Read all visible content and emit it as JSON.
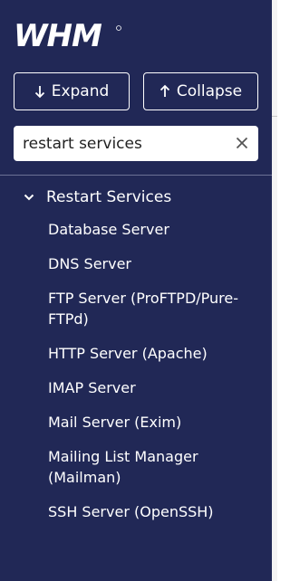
{
  "brand": {
    "logo_text": "WHM",
    "colors": {
      "sidebar_bg": "#212856",
      "text": "#ffffff",
      "search_bg": "#ffffff"
    }
  },
  "toolbar": {
    "expand_label": "Expand",
    "expand_icon": "arrow-down-icon",
    "collapse_label": "Collapse",
    "collapse_icon": "arrow-up-icon"
  },
  "search": {
    "value": "restart services",
    "placeholder": "",
    "clear_icon": "close-icon"
  },
  "nav": {
    "section": {
      "label": "Restart Services",
      "expanded": true,
      "icon": "chevron-down-icon"
    },
    "items": [
      {
        "label": "Database Server"
      },
      {
        "label": "DNS Server"
      },
      {
        "label": "FTP Server (ProFTPD/Pure-FTPd)"
      },
      {
        "label": "HTTP Server (Apache)"
      },
      {
        "label": "IMAP Server"
      },
      {
        "label": "Mail Server (Exim)"
      },
      {
        "label": "Mailing List Manager (Mailman)"
      },
      {
        "label": "SSH Server (OpenSSH)"
      }
    ]
  }
}
